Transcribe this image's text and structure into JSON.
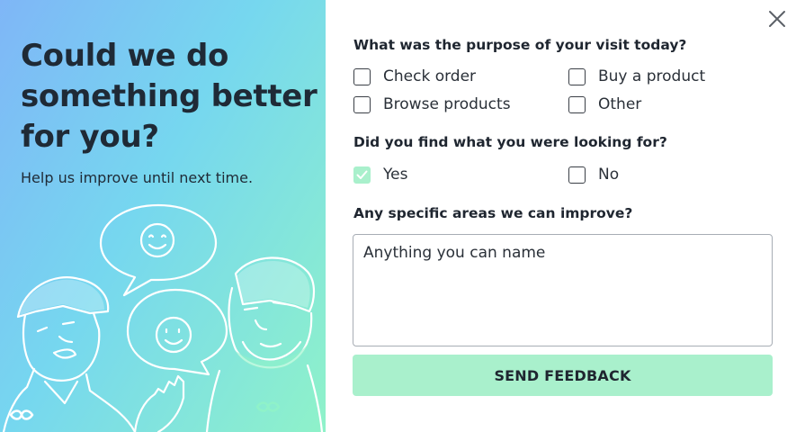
{
  "hero": {
    "headline": "Could we do something better for you?",
    "subline": "Help us improve until next time."
  },
  "survey": {
    "q1": {
      "label": "What was the purpose of your visit today?",
      "options": [
        {
          "label": "Check order",
          "checked": false
        },
        {
          "label": "Buy a product",
          "checked": false
        },
        {
          "label": "Browse products",
          "checked": false
        },
        {
          "label": "Other",
          "checked": false
        }
      ]
    },
    "q2": {
      "label": "Did you find what you were looking for?",
      "options": [
        {
          "label": "Yes",
          "checked": true
        },
        {
          "label": "No",
          "checked": false
        }
      ]
    },
    "q3": {
      "label": "Any specific areas we can improve?",
      "placeholder": "Anything you can name"
    },
    "submit_label": "SEND FEEDBACK"
  },
  "colors": {
    "accent": "#a9f0cc",
    "gradient_start": "#7fb6f7",
    "gradient_end": "#8ff2c9",
    "text": "#1f2630"
  },
  "icons": {
    "close": "close-icon",
    "check": "checkmark-icon",
    "logo": "infinity-icon"
  }
}
